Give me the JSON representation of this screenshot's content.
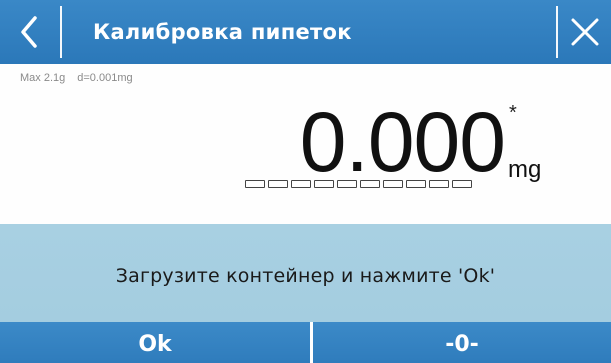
{
  "header": {
    "title": "Калибровка пипеток",
    "back_icon": "chevron-left-icon",
    "close_icon": "close-icon"
  },
  "display": {
    "max_capacity": "Max 2.1g",
    "division": "d=0.001mg",
    "value": "0.000",
    "stability_marker": "*",
    "unit": "mg",
    "bargraph_segments": 10,
    "bargraph_level": 0
  },
  "message": {
    "text": "Загрузите контейнер и нажмите 'Ok'"
  },
  "footer": {
    "ok_label": "Ok",
    "zero_label": "-0-"
  },
  "colors": {
    "header_blue": "#2f7dbd",
    "message_bg": "#a6cee1",
    "footer_blue": "#3482c2"
  }
}
